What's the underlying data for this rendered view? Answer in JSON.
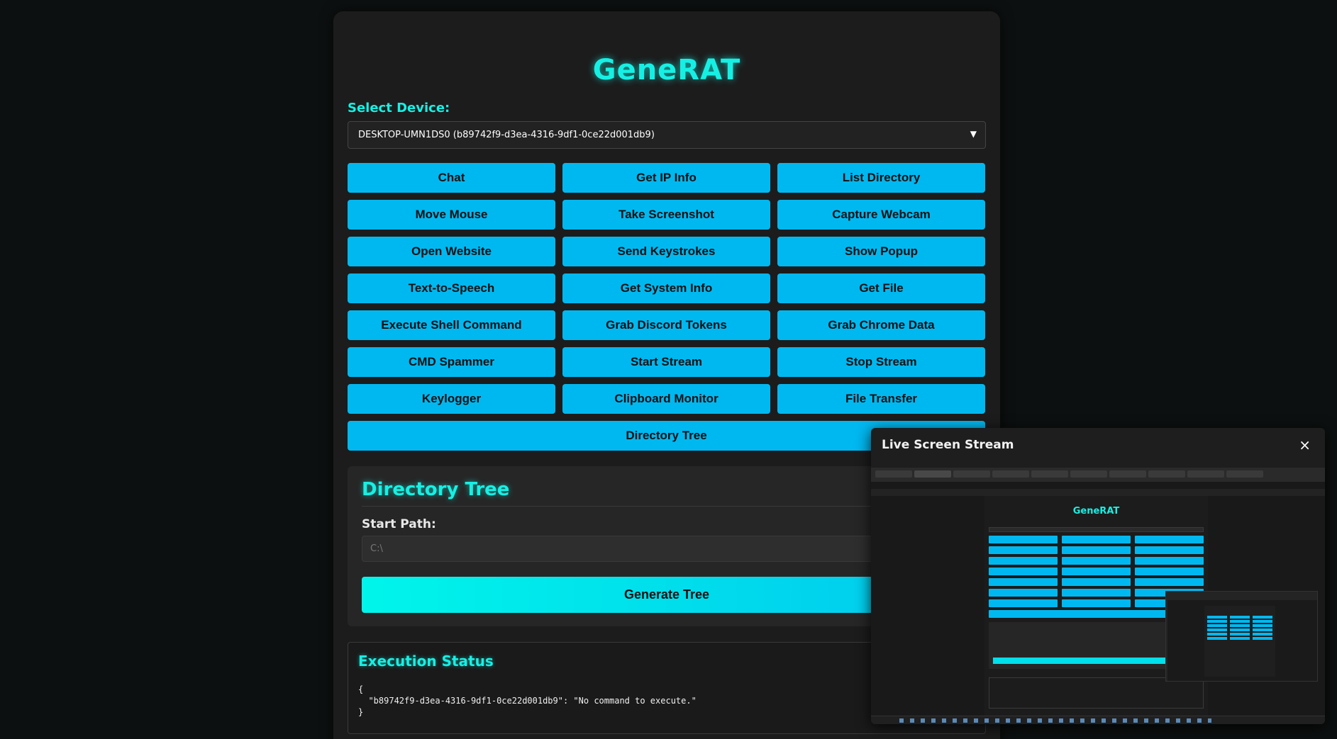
{
  "app": {
    "title": "GeneRAT"
  },
  "device": {
    "label": "Select Device:",
    "selected": "DESKTOP-UMN1DS0 (b89742f9-d3ea-4316-9df1-0ce22d001db9)"
  },
  "commands": [
    "Chat",
    "Get IP Info",
    "List Directory",
    "Move Mouse",
    "Take Screenshot",
    "Capture Webcam",
    "Open Website",
    "Send Keystrokes",
    "Show Popup",
    "Text-to-Speech",
    "Get System Info",
    "Get File",
    "Execute Shell Command",
    "Grab Discord Tokens",
    "Grab Chrome Data",
    "CMD Spammer",
    "Start Stream",
    "Stop Stream",
    "Keylogger",
    "Clipboard Monitor",
    "File Transfer",
    "Directory Tree"
  ],
  "directory_tree": {
    "title": "Directory Tree",
    "start_path_label": "Start Path:",
    "start_path_placeholder": "C:\\",
    "generate_label": "Generate Tree"
  },
  "execution_status": {
    "title": "Execution Status",
    "output": "{\n  \"b89742f9-d3ea-4316-9df1-0ce22d001db9\": \"No command to execute.\"\n}"
  },
  "stream_modal": {
    "title": "Live Screen Stream",
    "close_glyph": "×",
    "mini_title": "GeneRAT"
  },
  "colors": {
    "accent": "#16f0e4",
    "button": "#00b8f0",
    "background": "#0d1010",
    "panel": "#1c1c1c"
  }
}
